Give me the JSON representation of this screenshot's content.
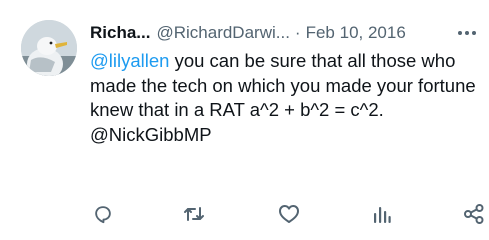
{
  "tweet": {
    "author_name": "Richa...",
    "author_handle": "@RichardDarwi...",
    "separator": "·",
    "date": "Feb 10, 2016",
    "mention_1": "@lilyallen",
    "text": " you can be sure that all those who made the tech on which you made your fortune knew that in a RAT a^2 + b^2 = c^2.",
    "mention_2": "@NickGibbMP"
  },
  "icons": {
    "more": "more-dots-icon",
    "reply": "reply-icon",
    "retweet": "retweet-icon",
    "like": "heart-icon",
    "views": "views-icon",
    "share": "share-icon"
  },
  "colors": {
    "text": "#0f1419",
    "secondary": "#536471",
    "link": "#1d9bf0"
  }
}
